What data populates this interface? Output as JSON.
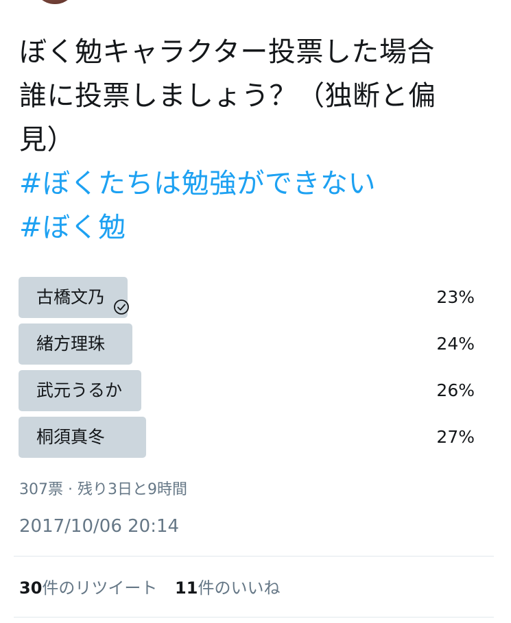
{
  "tweet": {
    "text_lines": [
      "ぼく勉キャラクター投票した場合",
      "誰に投票しましょう？（独断と偏",
      "見）"
    ],
    "hashtags": [
      "#ぼくたちは勉強ができない",
      "#ぼく勉"
    ]
  },
  "poll": {
    "options": [
      {
        "label": "古橋文乃",
        "percent_text": "23%",
        "percent": 23,
        "selected": true
      },
      {
        "label": "緒方理珠",
        "percent_text": "24%",
        "percent": 24,
        "selected": false
      },
      {
        "label": "武元うるか",
        "percent_text": "26%",
        "percent": 26,
        "selected": false
      },
      {
        "label": "桐須真冬",
        "percent_text": "27%",
        "percent": 27,
        "selected": false
      }
    ],
    "meta": "307票 · 残り3日と9時間"
  },
  "timestamp": "2017/10/06 20:14",
  "stats": {
    "retweets_count": "30",
    "retweets_label": "件のリツイート",
    "likes_count": "11",
    "likes_label": "件のいいね"
  },
  "colors": {
    "hashtag": "#1da1f2",
    "poll_bar": "#ccd6dd",
    "secondary_text": "#657786"
  }
}
